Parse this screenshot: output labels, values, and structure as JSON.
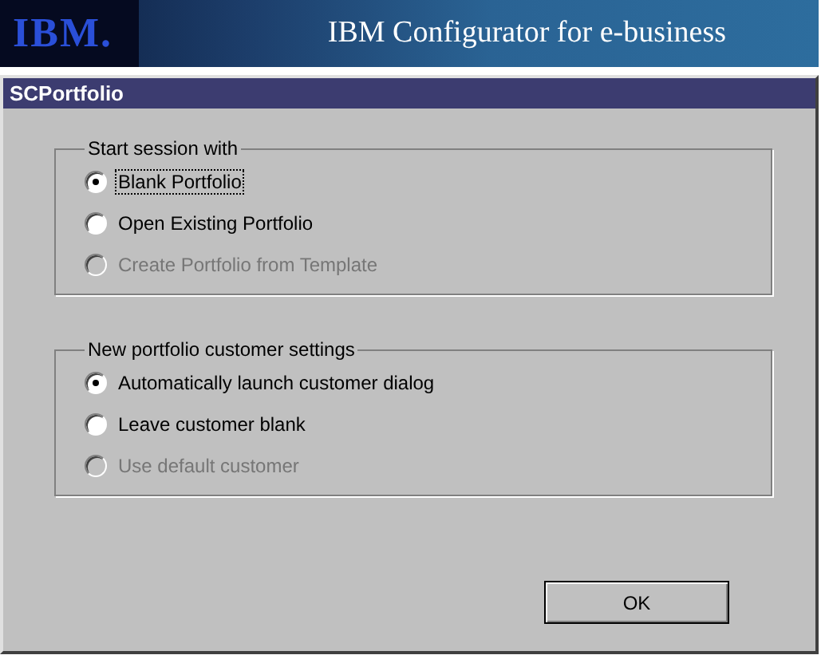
{
  "banner": {
    "logo": "IBM.",
    "title": "IBM Configurator for e-business"
  },
  "dialog": {
    "title": "SCPortfolio",
    "groups": [
      {
        "label": "Start session with",
        "options": [
          {
            "label": "Blank Portfolio",
            "selected": true,
            "disabled": false,
            "focused": true
          },
          {
            "label": "Open Existing Portfolio",
            "selected": false,
            "disabled": false,
            "focused": false
          },
          {
            "label": "Create Portfolio from Template",
            "selected": false,
            "disabled": true,
            "focused": false
          }
        ]
      },
      {
        "label": "New portfolio customer settings",
        "options": [
          {
            "label": "Automatically launch customer dialog",
            "selected": true,
            "disabled": false,
            "focused": false
          },
          {
            "label": "Leave customer blank",
            "selected": false,
            "disabled": false,
            "focused": false
          },
          {
            "label": "Use default customer",
            "selected": false,
            "disabled": true,
            "focused": false
          }
        ]
      }
    ],
    "buttons": [
      "OK"
    ]
  }
}
